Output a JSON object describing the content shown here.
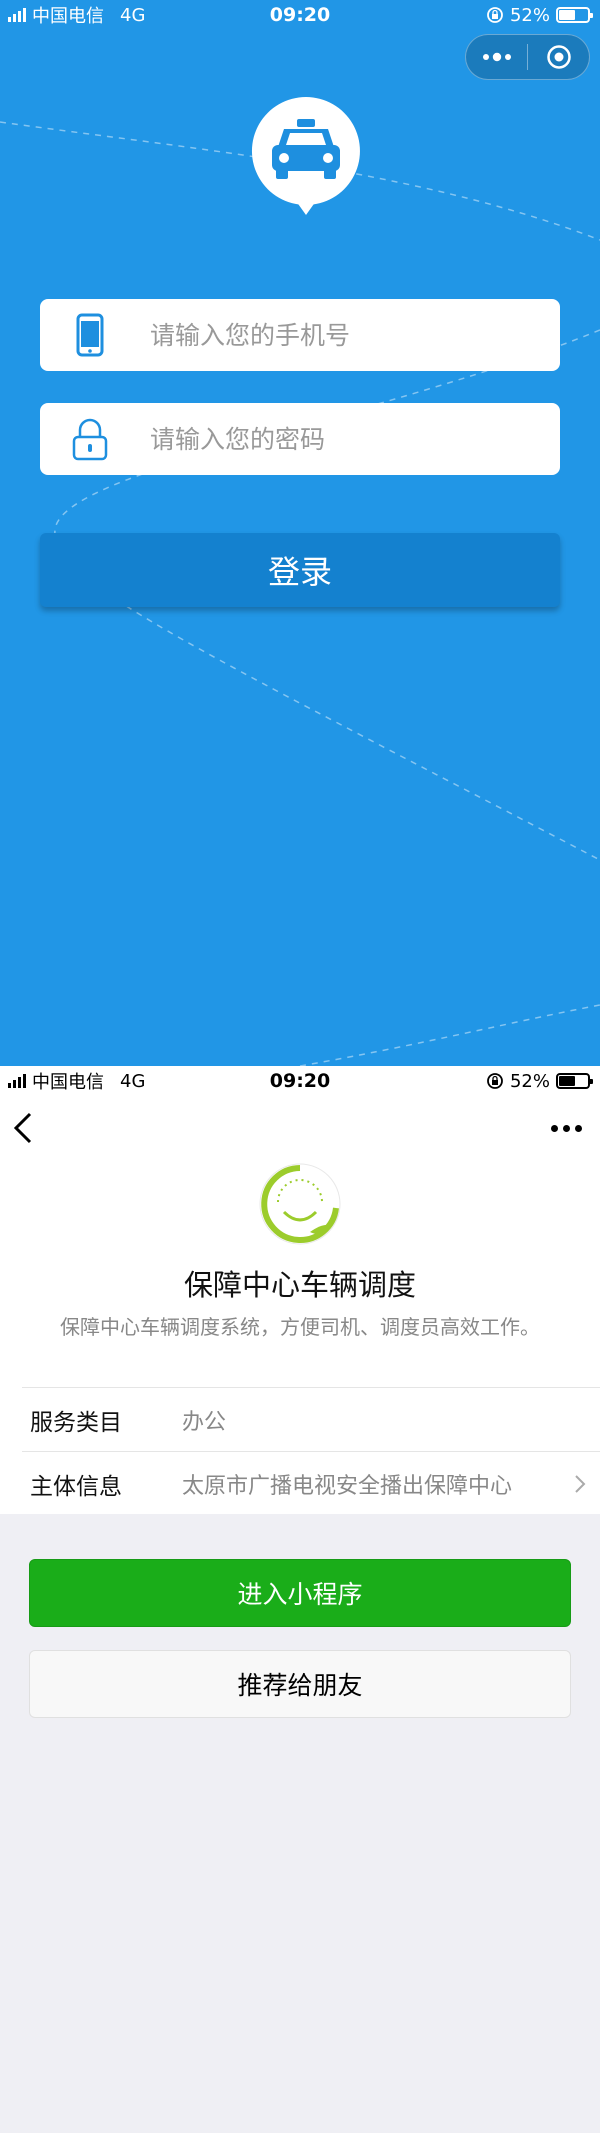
{
  "login_screen": {
    "status_bar": {
      "carrier": "中国电信",
      "network": "4G",
      "time": "09:20",
      "battery": "52%"
    },
    "phone_placeholder": "请输入您的手机号",
    "password_placeholder": "请输入您的密码",
    "login_label": "登录",
    "colors": {
      "background": "#2196e6",
      "button": "#1481cf"
    }
  },
  "profile_screen": {
    "status_bar": {
      "carrier": "中国电信",
      "network": "4G",
      "time": "09:20",
      "battery": "52%"
    },
    "app_name": "保障中心车辆调度",
    "app_description": "保障中心车辆调度系统，方便司机、调度员高效工作。",
    "info_rows": [
      {
        "label": "服务类目",
        "value": "办公"
      },
      {
        "label": "主体信息",
        "value": "太原市广播电视安全播出保障中心"
      }
    ],
    "enter_label": "进入小程序",
    "share_label": "推荐给朋友",
    "colors": {
      "enter_button": "#1aad19",
      "logo_green": "#9ccc2c"
    }
  },
  "icons": [
    "signal-icon",
    "battery-icon",
    "more-dots-icon",
    "close-target-icon",
    "taxi-logo-icon",
    "phone-icon",
    "lock-icon",
    "back-arrow-icon",
    "chevron-right-icon"
  ]
}
